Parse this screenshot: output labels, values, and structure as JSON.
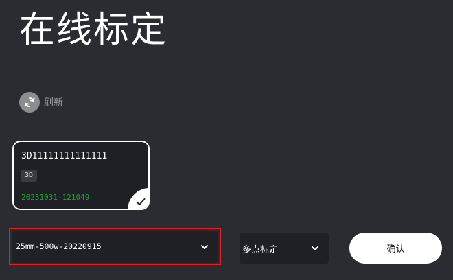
{
  "page": {
    "title": "在线标定"
  },
  "refresh": {
    "label": "刷新",
    "icon": "refresh-icon"
  },
  "device_card": {
    "name": "3D11111111111111",
    "type_badge": "3D",
    "timestamp": "20231031-121049",
    "selected": true,
    "timestamp_color": "#1fa22f"
  },
  "calibration_file_select": {
    "value": "25mm-500w-20220915",
    "highlight_color": "#e02020"
  },
  "mode_select": {
    "value": "多点标定"
  },
  "confirm_button": {
    "label": "确认"
  }
}
